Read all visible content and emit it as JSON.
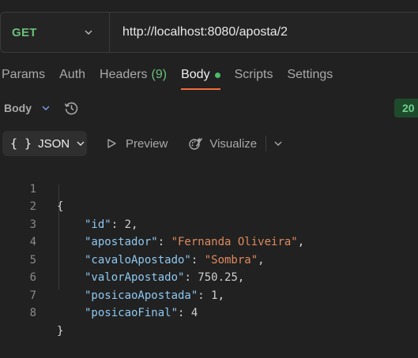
{
  "request": {
    "method": "GET",
    "url": "http://localhost:8080/aposta/2"
  },
  "tabs": [
    {
      "label": "Params"
    },
    {
      "label": "Auth"
    },
    {
      "label": "Headers",
      "count": "(9)"
    },
    {
      "label": "Body"
    },
    {
      "label": "Scripts"
    },
    {
      "label": "Settings"
    }
  ],
  "response": {
    "title": "Body",
    "status_code": "20",
    "format": "JSON",
    "preview_label": "Preview",
    "visualize_label": "Visualize"
  },
  "code": {
    "line_numbers": [
      "1",
      "2",
      "3",
      "4",
      "5",
      "6",
      "7",
      "8"
    ],
    "open_brace": "{",
    "close_brace": "}",
    "fields": [
      {
        "key": "\"id\"",
        "value": "2",
        "type": "num",
        "comma": ","
      },
      {
        "key": "\"apostador\"",
        "value": "\"Fernanda Oliveira\"",
        "type": "str",
        "comma": ","
      },
      {
        "key": "\"cavaloApostado\"",
        "value": "\"Sombra\"",
        "type": "str",
        "comma": ","
      },
      {
        "key": "\"valorApostado\"",
        "value": "750.25",
        "type": "num",
        "comma": ","
      },
      {
        "key": "\"posicaoApostada\"",
        "value": "1",
        "type": "num",
        "comma": ","
      },
      {
        "key": "\"posicaoFinal\"",
        "value": "4",
        "type": "num",
        "comma": ""
      }
    ]
  },
  "colors": {
    "method": "#6bbf7a",
    "active_tab_underline": "#f26b3a",
    "status_dot": "#4cbb6a",
    "json_key": "#8ec8f0",
    "json_string": "#e08a5e"
  }
}
